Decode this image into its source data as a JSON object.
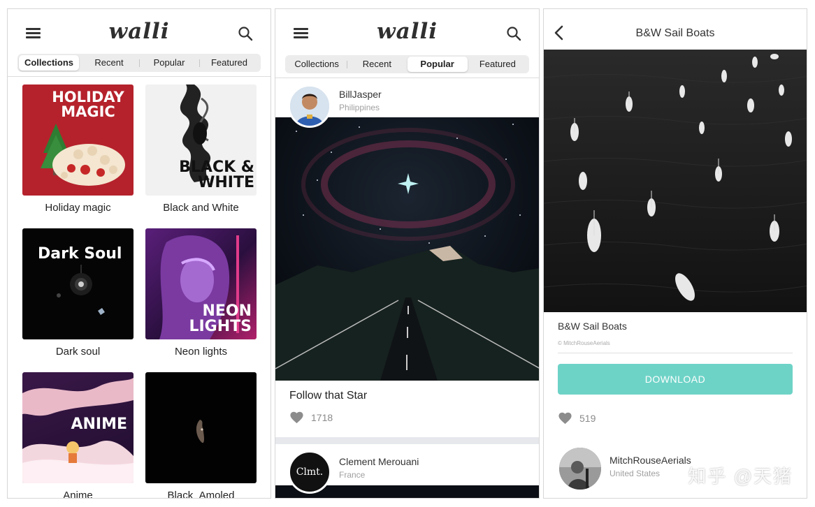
{
  "app": {
    "logo": "walli"
  },
  "tabs": [
    "Collections",
    "Recent",
    "Popular",
    "Featured"
  ],
  "screen1": {
    "active_tab": "Collections",
    "collections": [
      {
        "tile_title": "HOLIDAY MAGIC",
        "caption": "Holiday magic",
        "bg": "#b5222c"
      },
      {
        "tile_title": "BLACK & WHITE",
        "caption": "Black and White",
        "bg": "#f1f1f1"
      },
      {
        "tile_title": "Dark Soul",
        "caption": "Dark soul",
        "bg": "#050505"
      },
      {
        "tile_title": "NEON LIGHTS",
        "caption": "Neon lights",
        "bg": "#3a1450"
      },
      {
        "tile_title": "ANIME",
        "caption": "Anime",
        "bg": "#2a1238"
      },
      {
        "tile_title": "",
        "caption": "Black_Amoled",
        "bg": "#020202"
      }
    ]
  },
  "screen2": {
    "active_tab": "Popular",
    "posts": [
      {
        "user": "BillJasper",
        "location": "Philippines",
        "title": "Follow that Star",
        "likes": "1718"
      },
      {
        "user": "Clement Merouani",
        "location": "France",
        "avatar_text": "Clmt."
      }
    ]
  },
  "screen3": {
    "title": "B&W Sail Boats",
    "name": "B&W Sail Boats",
    "credit": "© MitchRouseAerials",
    "download_label": "DOWNLOAD",
    "likes": "519",
    "user": "MitchRouseAerials",
    "location": "United States",
    "watermark": "知乎 @天猪"
  },
  "colors": {
    "accent": "#6ed3c7",
    "heart": "#8c8c8c",
    "separator": "#e6e8ec"
  }
}
